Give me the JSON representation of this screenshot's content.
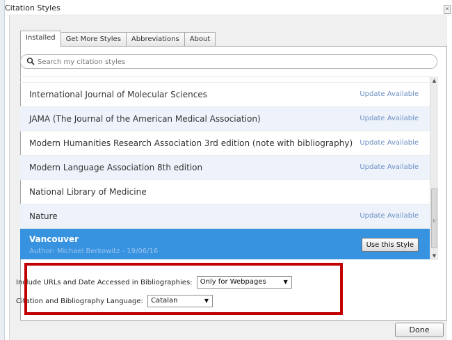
{
  "window": {
    "title": "Citation Styles"
  },
  "tabs": [
    {
      "label": "Installed",
      "active": true
    },
    {
      "label": "Get More Styles",
      "active": false
    },
    {
      "label": "Abbreviations",
      "active": false
    },
    {
      "label": "About",
      "active": false
    }
  ],
  "search": {
    "placeholder": "Search my citation styles",
    "value": ""
  },
  "styles": [
    {
      "name": "International Journal of Molecular Sciences",
      "status": "Update Available"
    },
    {
      "name": "JAMA (The Journal of the American Medical Association)",
      "status": "Update Available"
    },
    {
      "name": "Modern Humanities Research Association 3rd edition (note with bibliography)",
      "status": "Update Available"
    },
    {
      "name": "Modern Language Association 8th edition",
      "status": "Update Available"
    },
    {
      "name": "National Library of Medicine",
      "status": ""
    },
    {
      "name": "Nature",
      "status": "Update Available"
    }
  ],
  "selected_style": {
    "name": "Vancouver",
    "author": "Author: Michael Berkowitz - 19/06/16",
    "button_label": "Use this Style"
  },
  "settings": {
    "urls_label": "Include URLs and Date Accessed in Bibliographies:",
    "urls_value": "Only for Webpages",
    "language_label": "Citation and Bibliography Language:",
    "language_value": "Catalan"
  },
  "footer": {
    "done_label": "Done"
  },
  "colors": {
    "selection": "#3793e0",
    "update_link": "#6c8fc4",
    "highlight_box": "#c00000",
    "alt_row": "#eef3fb"
  },
  "icons": [
    "search-icon",
    "close-icon",
    "chevron-down-icon",
    "scroll-up-arrow-icon",
    "scroll-down-arrow-icon"
  ]
}
